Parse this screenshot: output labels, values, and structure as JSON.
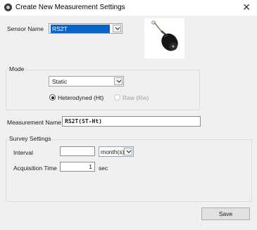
{
  "window": {
    "title": "Create New Measurement Settings",
    "close_glyph": "✕"
  },
  "sensor": {
    "label": "Sensor Name",
    "value": "RS2T"
  },
  "mode": {
    "group_label": "Mode",
    "value": "Static",
    "options": [
      {
        "label": "Heterodyned (Ht)",
        "checked": true,
        "enabled": true
      },
      {
        "label": "Raw (Rw)",
        "checked": false,
        "enabled": false
      }
    ]
  },
  "measurement": {
    "label": "Measurement Name",
    "value": "RS2T(ST-Ht)"
  },
  "survey": {
    "group_label": "Survey Settings",
    "interval_label": "Interval",
    "interval_value": "",
    "interval_unit": "month(s)",
    "acq_label": "Acquisition Time",
    "acq_value": "1",
    "acq_unit": "sec"
  },
  "save_label": "Save",
  "icons": {
    "app": "app-logo-icon",
    "sensor": "sensor-device-icon",
    "dropdown": "chevron-down-icon"
  }
}
